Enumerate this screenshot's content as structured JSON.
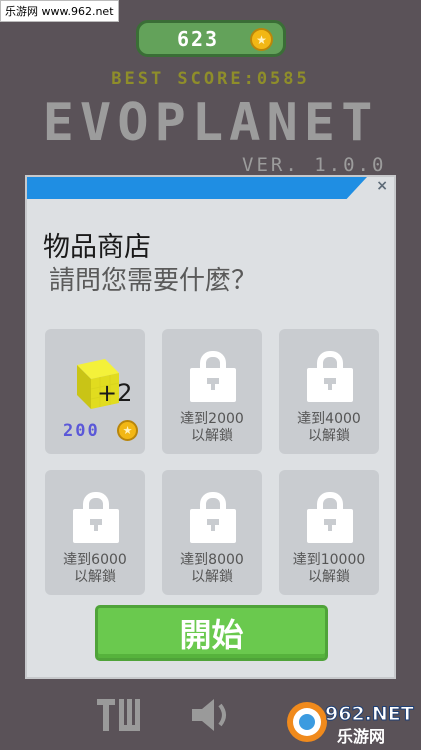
{
  "watermark_top": "乐游网 www.962.net",
  "header": {
    "coins": "623",
    "best_score": "BEST SCORE:0585",
    "game_title": "EVOPLANET",
    "version": "VER. 1.0.0"
  },
  "panel": {
    "title": "物品商店",
    "subtitle": "請問您需要什麼？",
    "items": [
      {
        "qty": "+2",
        "price": "200"
      },
      {
        "locked_text_line1": "達到2000",
        "locked_text_line2": "以解鎖"
      },
      {
        "locked_text_line1": "達到4000",
        "locked_text_line2": "以解鎖"
      },
      {
        "locked_text_line1": "達到6000",
        "locked_text_line2": "以解鎖"
      },
      {
        "locked_text_line1": "達到8000",
        "locked_text_line2": "以解鎖"
      },
      {
        "locked_text_line1": "達到10000",
        "locked_text_line2": "以解鎖"
      }
    ],
    "start_label": "開始"
  },
  "watermark_bottom": {
    "line1": "962.NET",
    "line2": "乐游网"
  },
  "colors": {
    "background": "#5a5258",
    "coin_pill": "#63a25a",
    "header_bar": "#1f8ee3",
    "start_button": "#6ac94e",
    "price": "#5b58d8",
    "best_score": "#8f8e2a"
  },
  "icons": [
    "coin-icon",
    "lock-icon",
    "yellow-cube-icon",
    "leaderboard-icon",
    "sound-icon",
    "close-icon"
  ]
}
